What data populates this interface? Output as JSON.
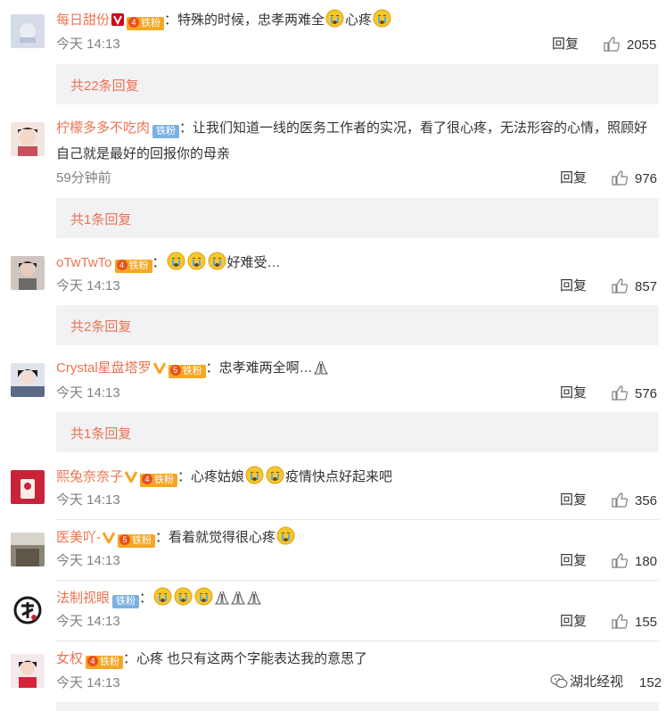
{
  "comments": [
    {
      "name": "每日甜份",
      "text": "：特殊的时候，忠孝两难全",
      "trail": "心疼",
      "time": "今天 14:13",
      "likes": "2055",
      "reply_label": "回复",
      "more": "共22条回复",
      "lv": "4",
      "badge": "铁粉"
    },
    {
      "name": "柠檬多多不吃肉",
      "text": "：让我们知道一线的医务工作者的实况，看了很心疼，无法形容的心情，照顾好自己就是最好的回报你的母亲",
      "time": "59分钟前",
      "likes": "976",
      "reply_label": "回复",
      "more": "共1条回复",
      "badge": "铁粉"
    },
    {
      "name": "oTwTwTo",
      "text": "：",
      "trail": "好难受…",
      "time": "今天 14:13",
      "likes": "857",
      "reply_label": "回复",
      "more": "共2条回复",
      "lv": "4",
      "badge": "铁粉"
    },
    {
      "name": "Crystal星盘塔罗",
      "text": "：忠孝难两全啊…",
      "time": "今天 14:13",
      "likes": "576",
      "reply_label": "回复",
      "more": "共1条回复",
      "lv": "5",
      "badge": "铁粉"
    },
    {
      "name": "熙兔奈奈子",
      "text": "：心疼姑娘",
      "trail": "疫情快点好起来吧",
      "time": "今天 14:13",
      "likes": "356",
      "reply_label": "回复",
      "lv": "4",
      "badge": "铁粉"
    },
    {
      "name": "医美吖-",
      "text": "：看着就觉得很心疼",
      "time": "今天 14:13",
      "likes": "180",
      "reply_label": "回复",
      "lv": "5",
      "badge": "铁粉"
    },
    {
      "name": "法制视眼",
      "text": "：",
      "time": "今天 14:13",
      "likes": "155",
      "reply_label": "回复",
      "badge": "铁粉"
    },
    {
      "name": "女权",
      "text": "：心疼  也只有这两个字能表达我的意思了",
      "time": "今天 14:13",
      "likes": "152",
      "reply_label": "回复",
      "lv": "4",
      "badge": "铁粉"
    }
  ],
  "watermark": "湖北经视",
  "colors": {
    "name": "#eb7350",
    "reply_box": "#f2f2f5",
    "time": "#808080",
    "fan_badge": "#7cb0e3",
    "level_badge": "#f5a623"
  }
}
